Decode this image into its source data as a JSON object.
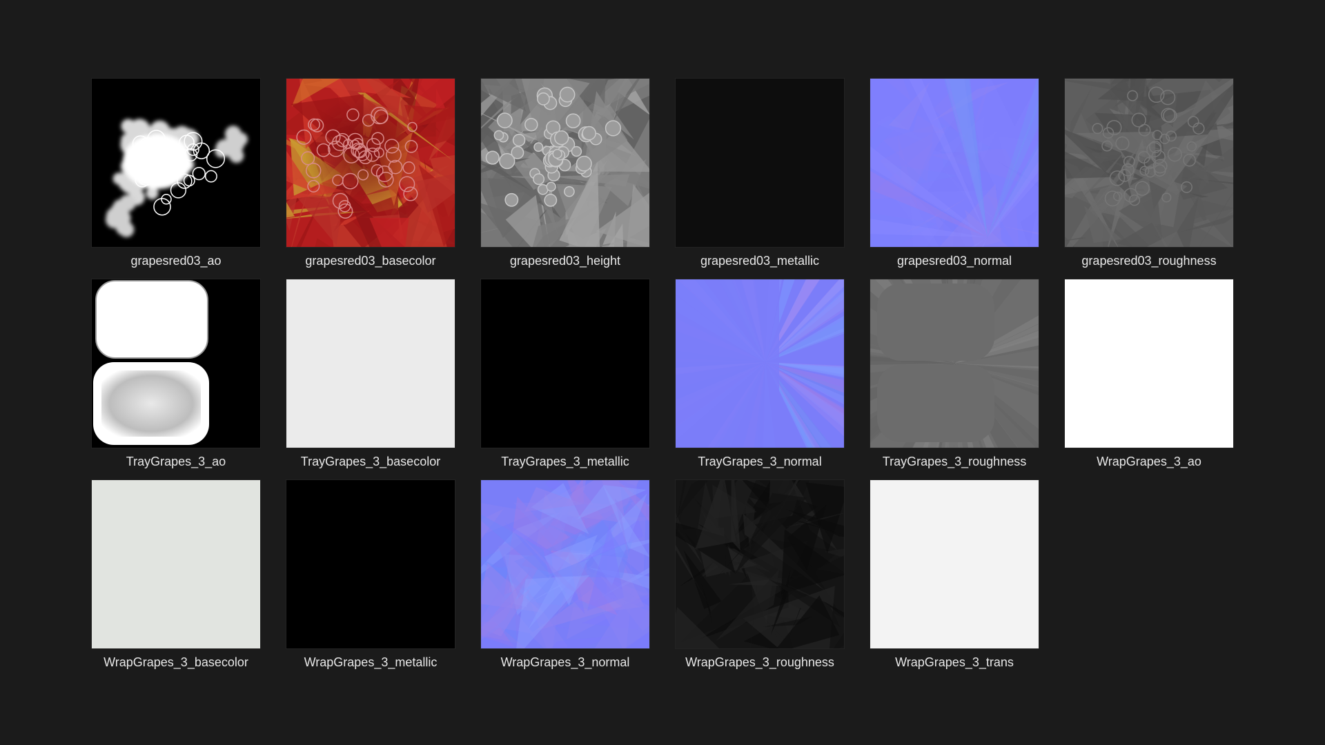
{
  "items": [
    {
      "name": "grapesred03_ao",
      "swatch": "ao"
    },
    {
      "name": "grapesred03_basecolor",
      "swatch": "basecolor"
    },
    {
      "name": "grapesred03_height",
      "swatch": "height"
    },
    {
      "name": "grapesred03_metallic",
      "swatch": "metallic"
    },
    {
      "name": "grapesred03_normal",
      "swatch": "normal"
    },
    {
      "name": "grapesred03_roughness",
      "swatch": "roughness"
    },
    {
      "name": "TrayGrapes_3_ao",
      "swatch": "tray-ao"
    },
    {
      "name": "TrayGrapes_3_basecolor",
      "swatch": "flat",
      "color": "#ebebeb"
    },
    {
      "name": "TrayGrapes_3_metallic",
      "swatch": "flat",
      "color": "#000000"
    },
    {
      "name": "TrayGrapes_3_normal",
      "swatch": "tray-normal"
    },
    {
      "name": "TrayGrapes_3_roughness",
      "swatch": "tray-roughness"
    },
    {
      "name": "WrapGrapes_3_ao",
      "swatch": "flat",
      "color": "#ffffff"
    },
    {
      "name": "WrapGrapes_3_basecolor",
      "swatch": "flat",
      "color": "#e1e4e0"
    },
    {
      "name": "WrapGrapes_3_metallic",
      "swatch": "flat",
      "color": "#000000"
    },
    {
      "name": "WrapGrapes_3_normal",
      "swatch": "wrap-normal"
    },
    {
      "name": "WrapGrapes_3_roughness",
      "swatch": "wrap-roughness"
    },
    {
      "name": "WrapGrapes_3_trans",
      "swatch": "flat",
      "color": "#f3f3f3"
    }
  ],
  "colors": {
    "background": "#1b1b1b",
    "label": "#e8e8e8"
  }
}
